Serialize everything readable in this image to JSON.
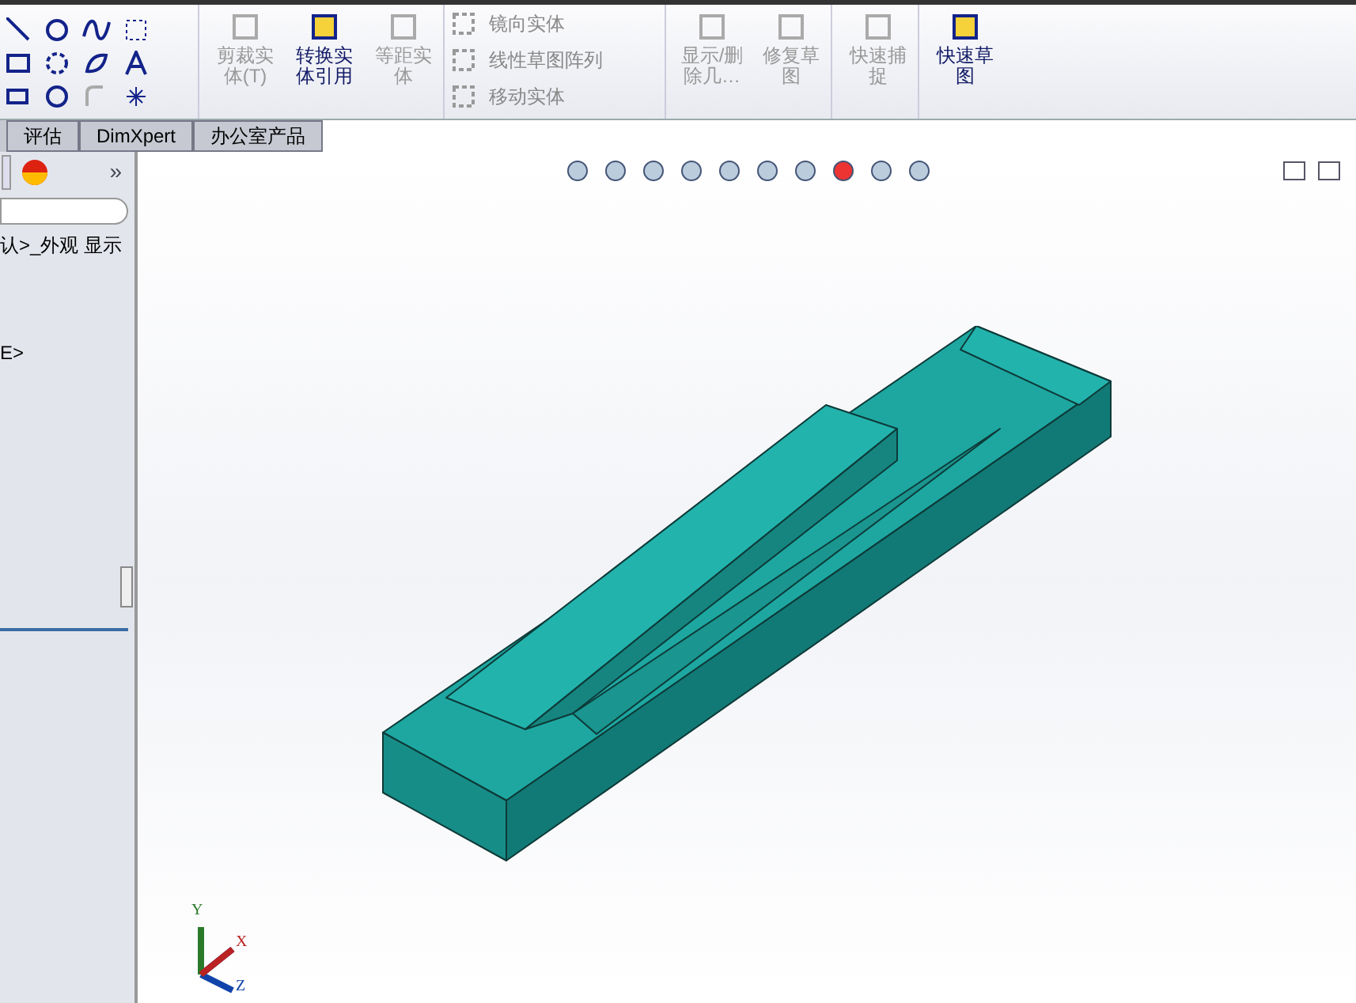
{
  "toolbar": {
    "groups": [
      {
        "kind": "large",
        "items": [
          {
            "label": "剪裁实体(T)",
            "disabled": true
          },
          {
            "label": "转换实体引用",
            "disabled": false
          },
          {
            "label": "等距实体",
            "disabled": true
          }
        ]
      },
      {
        "kind": "small",
        "items": [
          {
            "label": "镜向实体",
            "disabled": true
          },
          {
            "label": "线性草图阵列",
            "disabled": true
          },
          {
            "label": "移动实体",
            "disabled": true
          }
        ]
      },
      {
        "kind": "large",
        "items": [
          {
            "label": "显示/删除几…",
            "disabled": true
          },
          {
            "label": "修复草图",
            "disabled": true
          }
        ]
      },
      {
        "kind": "large",
        "items": [
          {
            "label": "快速捕捉",
            "disabled": true
          }
        ]
      },
      {
        "kind": "large",
        "items": [
          {
            "label": "快速草图",
            "disabled": false
          }
        ]
      }
    ]
  },
  "tabs": [
    {
      "label": "评估",
      "selected": false
    },
    {
      "label": "DimXpert",
      "selected": false
    },
    {
      "label": "办公室产品",
      "selected": false
    }
  ],
  "panel": {
    "more": "»",
    "lines": [
      "认>_外观 显示",
      "E>"
    ]
  },
  "triad": {
    "axes": [
      "Y",
      "X",
      "Z"
    ]
  }
}
